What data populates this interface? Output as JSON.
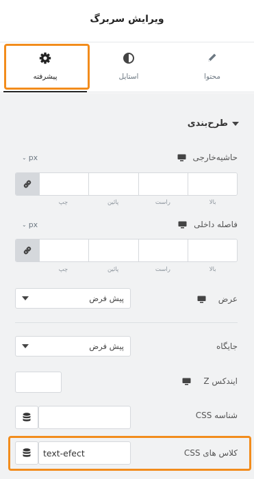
{
  "header": {
    "title": "ویرایش سربرگ"
  },
  "tabs": [
    {
      "label": "محتوا",
      "icon": "pencil-icon"
    },
    {
      "label": "استایل",
      "icon": "contrast-icon"
    },
    {
      "label": "پیشرفته",
      "icon": "gear-icon"
    }
  ],
  "section": {
    "title": "طرح‌بندی"
  },
  "margin": {
    "label": "حاشیه‌خارجی",
    "unit": "px",
    "sides": [
      "بالا",
      "راست",
      "پائین",
      "چپ"
    ]
  },
  "padding": {
    "label": "فاصله داخلی",
    "unit": "px",
    "sides": [
      "بالا",
      "راست",
      "پائین",
      "چپ"
    ]
  },
  "width": {
    "label": "عرض",
    "value": "پیش فرض"
  },
  "position": {
    "label": "جایگاه",
    "value": "پیش فرض"
  },
  "zindex": {
    "label": "ایندکس Z",
    "value": ""
  },
  "css_id": {
    "label": "شناسه CSS",
    "value": ""
  },
  "css_classes": {
    "label": "کلاس های CSS",
    "value": "text-efect"
  },
  "colors": {
    "highlight": "#f28c1c",
    "panel": "#f1f2f3"
  }
}
